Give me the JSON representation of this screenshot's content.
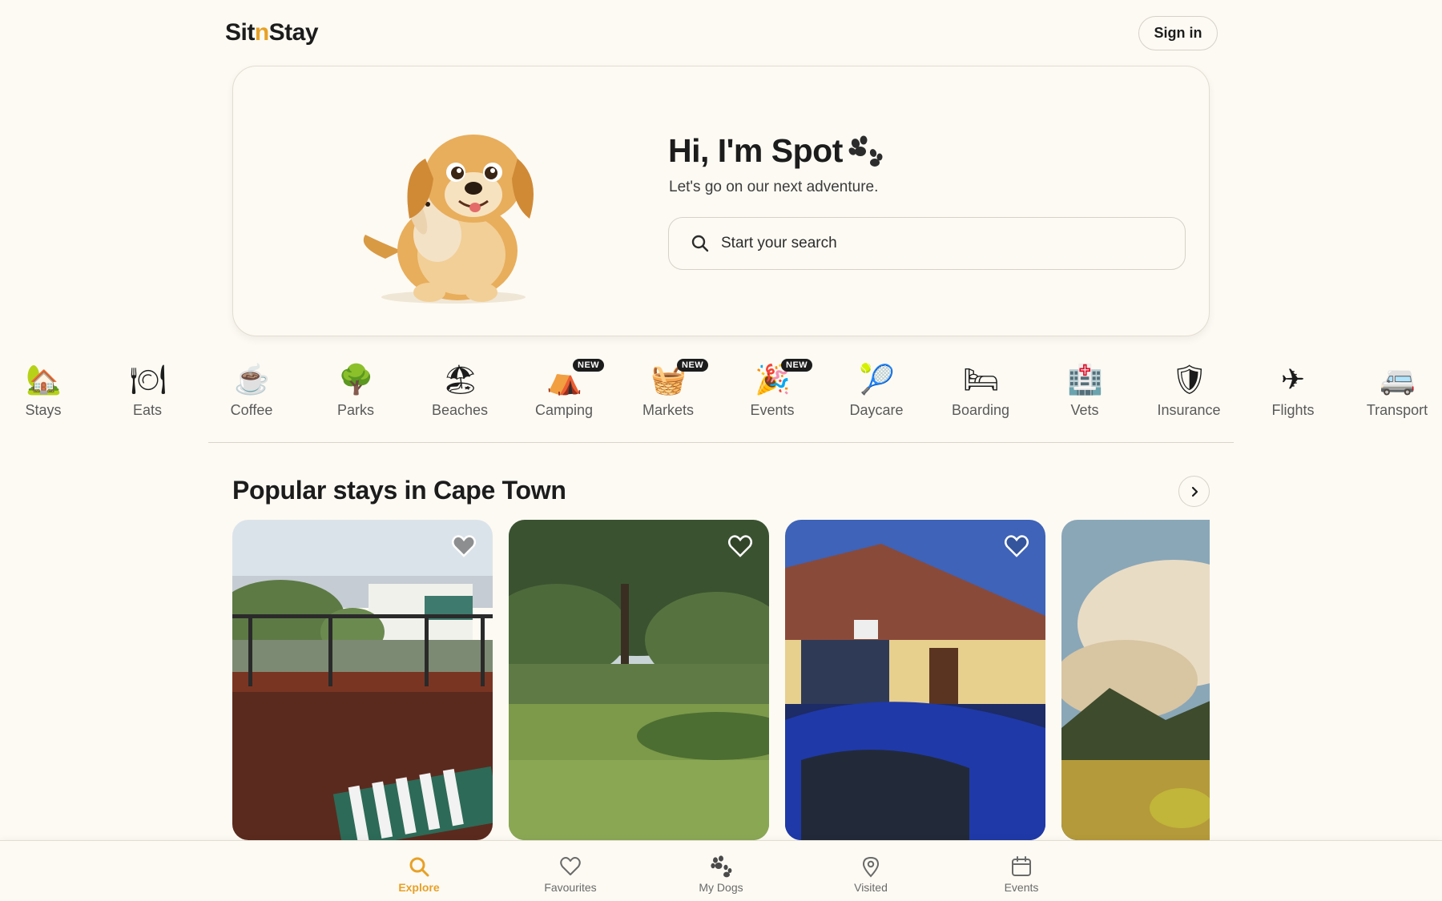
{
  "header": {
    "logo_part1": "Sit",
    "logo_part2": "n",
    "logo_part3": "Stay",
    "signin_label": "Sign in"
  },
  "hero": {
    "title": "Hi, I'm Spot",
    "subtitle": "Let's go on our next adventure.",
    "search_placeholder": "Start your search"
  },
  "categories": [
    {
      "label": "Stays",
      "icon": "🏡"
    },
    {
      "label": "Eats",
      "icon": "🍽"
    },
    {
      "label": "Coffee",
      "icon": "☕"
    },
    {
      "label": "Parks",
      "icon": "🌳"
    },
    {
      "label": "Beaches",
      "icon": "🏖"
    },
    {
      "label": "Camping",
      "icon": "⛺",
      "badge": "NEW"
    },
    {
      "label": "Markets",
      "icon": "🧺",
      "badge": "NEW"
    },
    {
      "label": "Events",
      "icon": "🎉",
      "badge": "NEW"
    },
    {
      "label": "Daycare",
      "icon": "🎾"
    },
    {
      "label": "Boarding",
      "icon": "🛏"
    },
    {
      "label": "Vets",
      "icon": "🏥"
    },
    {
      "label": "Insurance",
      "icon": "🛡"
    },
    {
      "label": "Flights",
      "icon": "✈"
    },
    {
      "label": "Transport",
      "icon": "🚐"
    }
  ],
  "section": {
    "title": "Popular stays in Cape Town"
  },
  "bottom_nav": [
    {
      "label": "Explore",
      "active": true
    },
    {
      "label": "Favourites"
    },
    {
      "label": "My Dogs"
    },
    {
      "label": "Visited"
    },
    {
      "label": "Events"
    }
  ],
  "colors": {
    "accent": "#e7a126",
    "background": "#fdfaf3",
    "text": "#1c1c1c"
  }
}
